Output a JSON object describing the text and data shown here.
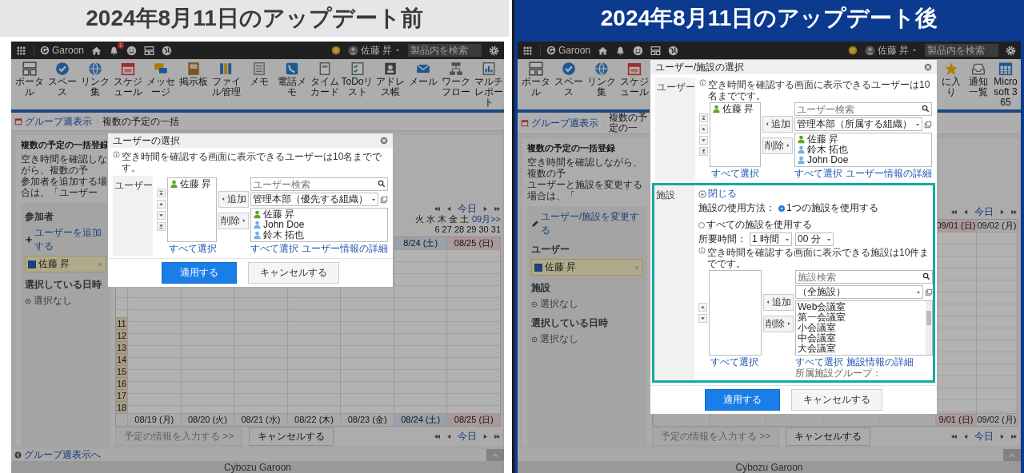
{
  "panels": [
    {
      "kind": "before",
      "heading": "2024年8月11日のアップデート前",
      "topbar": {
        "logo": "Garoon",
        "badge": "1",
        "user": "佐藤 昇",
        "search_placeholder": "製品内を検索"
      },
      "apps": [
        "ポータル",
        "スペース",
        "リンク集",
        "スケジュール",
        "メッセージ",
        "掲示板",
        "ファイル管理",
        "メモ",
        "電話メモ",
        "タイムカード",
        "ToDoリスト",
        "アドレス帳",
        "メール",
        "ワークフロー",
        "マルチレポート"
      ],
      "breadcrumb": {
        "root": "グループ週表示",
        "current": "複数の予定の一括"
      },
      "page": {
        "title": "複数の予定の一括登録",
        "description": [
          "空き時間を確認しながら、複数の予",
          "参加者を追加する場合は、「ユーザー"
        ]
      },
      "sidebar": [
        {
          "kind": "heading",
          "text": "参加者"
        },
        {
          "kind": "add-link",
          "text": "ユーザーを追加する"
        },
        {
          "kind": "chip",
          "text": "佐藤 昇",
          "checked": true
        },
        {
          "kind": "heading",
          "text": "選択している日時"
        },
        {
          "kind": "none",
          "text": "選択なし"
        }
      ],
      "calendar": {
        "today": "今日",
        "mini_calendar": {
          "weekdays": "火 水 木 金 土",
          "next": "09月>>",
          "dates": "6 27 28 29 30 31"
        },
        "hours": [
          "11",
          "12",
          "13",
          "14",
          "15",
          "16",
          "17",
          "18"
        ],
        "columns": [
          {
            "date": "08/19 (月)",
            "kind": "weekday"
          },
          {
            "date": "08/20 (火)",
            "kind": "weekday"
          },
          {
            "date": "08/21 (水)",
            "kind": "weekday"
          },
          {
            "date": "08/22 (木)",
            "kind": "weekday"
          },
          {
            "date": "08/23 (金)",
            "kind": "weekday"
          },
          {
            "date": "08/24 (土)",
            "kind": "saturday",
            "header": "8/24 (土)"
          },
          {
            "date": "08/25 (日)",
            "kind": "sunday",
            "header": "08/25 (日)"
          }
        ],
        "submit": "予定の情報を入力する >>",
        "submit_disabled": true,
        "cancel": "キャンセルする",
        "bottom_today": "今日"
      },
      "footer_link": "グループ週表示へ",
      "credit": "Cybozu Garoon",
      "dialog": {
        "title": "ユーザーの選択",
        "note": "空き時間を確認する画面に表示できるユーザーは10名までです。",
        "sections": [
          {
            "kind": "users",
            "label": "ユーザー",
            "selected": [
              {
                "name": "佐藤 昇",
                "color": "#5fa526"
              }
            ],
            "add": "追加",
            "remove": "削除",
            "search_placeholder": "ユーザー検索",
            "group": "管理本部（優先する組織）",
            "candidates": [
              {
                "name": "佐藤 昇",
                "color": "#5fa526"
              },
              {
                "name": "John Doe",
                "color": "#6fb0e6"
              },
              {
                "name": "鈴木 拓也",
                "color": "#6fb0e6"
              }
            ],
            "select_all_left": "すべて選択",
            "select_all_right": "すべて選択",
            "detail_link": "ユーザー情報の詳細"
          }
        ],
        "apply": "適用する",
        "cancel": "キャンセルする"
      }
    },
    {
      "kind": "after",
      "heading": "2024年8月11日のアップデート後",
      "topbar": {
        "logo": "Garoon",
        "user": "佐藤 昇",
        "search_placeholder": "製品内を検索"
      },
      "apps": [
        "ポータル",
        "スペース",
        "リンク集",
        "スケジュール"
      ],
      "apps_end": [
        "に入り",
        "通知一覧",
        "Microsoft 365"
      ],
      "breadcrumb": {
        "root": "グループ週表示",
        "current": "複数の予定の一"
      },
      "page": {
        "title": "複数の予定の一括登録",
        "description": [
          "空き時間を確認しながら、複数の予",
          "ユーザーと施設を変更する場合は、「"
        ]
      },
      "sidebar": [
        {
          "kind": "edit-link",
          "text": "ユーザー/施設を変更する"
        },
        {
          "kind": "heading",
          "text": "ユーザー"
        },
        {
          "kind": "chip",
          "text": "佐藤 昇",
          "checked": true
        },
        {
          "kind": "heading",
          "text": "施設"
        },
        {
          "kind": "none",
          "text": "選択なし"
        },
        {
          "kind": "heading",
          "text": "選択している日時"
        },
        {
          "kind": "none",
          "text": "選択なし"
        }
      ],
      "calendar": {
        "today": "今日",
        "columns": [
          {
            "date": "9/01 (日)",
            "kind": "sunday",
            "header": "09/01 (日)"
          },
          {
            "date": "09/02 (月)",
            "kind": "weekday",
            "header": "09/02 (月)"
          }
        ],
        "submit": "予定の情報を入力する >>",
        "submit_disabled": true,
        "cancel": "キャンセルする",
        "bottom_today": "今日"
      },
      "credit": "Cybozu Garoon",
      "dialog": {
        "title": "ユーザー/施設の選択",
        "sections": [
          {
            "kind": "users",
            "label": "ユーザー",
            "note": "空き時間を確認する画面に表示できるユーザーは10名までです。",
            "selected": [
              {
                "name": "佐藤 昇",
                "color": "#5fa526"
              }
            ],
            "add": "追加",
            "remove": "削除",
            "search_placeholder": "ユーザー検索",
            "group": "管理本部（所属する組織）",
            "candidates": [
              {
                "name": "佐藤 昇",
                "color": "#5fa526"
              },
              {
                "name": "鈴木 拓也",
                "color": "#6fb0e6"
              },
              {
                "name": "John Doe",
                "color": "#6fb0e6"
              }
            ],
            "select_all_left": "すべて選択",
            "select_all_right": "すべて選択",
            "detail_link": "ユーザー情報の詳細"
          },
          {
            "kind": "facilities",
            "label": "施設",
            "highlighted": true,
            "toggle": "閉じる",
            "usage_label": "施設の使用方法：",
            "usage_options": [
              {
                "label": "1つの施設を使用する",
                "selected": true
              },
              {
                "label": "すべての施設を使用する",
                "selected": false
              }
            ],
            "duration_label": "所要時間：",
            "hour": "1 時間",
            "minute": "00 分",
            "note": "空き時間を確認する画面に表示できる施設は10件までです。",
            "add": "追加",
            "remove": "削除",
            "search_placeholder": "施設検索",
            "group": "（全施設）",
            "candidates": [
              {
                "name": "Web会議室"
              },
              {
                "name": "第一会議室"
              },
              {
                "name": "小会議室"
              },
              {
                "name": "中会議室"
              },
              {
                "name": "大会議室"
              }
            ],
            "select_all_left": "すべて選択",
            "select_all_right": "すべて選択",
            "detail_link": "施設情報の詳細",
            "group_info": "所属施設グループ："
          }
        ],
        "apply": "適用する",
        "cancel": "キャンセルする"
      }
    }
  ]
}
